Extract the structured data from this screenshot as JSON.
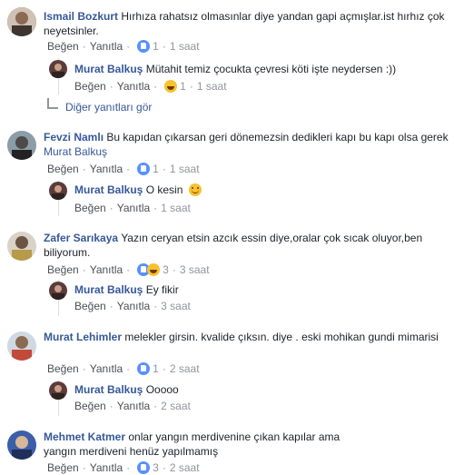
{
  "labels": {
    "like": "Beğen",
    "reply": "Yanıtla",
    "more_replies": "Diğer yanıtları gör"
  },
  "comments": [
    {
      "author": "Ismail Bozkurt",
      "text": "Hırhıza rahatsız olmasınlar diye yandan gapi açmışlar.ist hırhız çok neyetsinler.",
      "reaction": "like",
      "count": "1",
      "time": "1 saat",
      "reply": {
        "author": "Murat Balkuş",
        "text": "Mütahit temiz çocukta çevresi köti işte neydersen :))",
        "reaction": "haha",
        "count": "1",
        "time": "1 saat"
      }
    },
    {
      "author": "Fevzi Namlı",
      "text": "Bu kapıdan çıkarsan geri dönemezsin dedikleri kapı bu kapı olsa gerek",
      "mention": "Murat Balkuş",
      "reaction": "like",
      "count": "1",
      "time": "1 saat",
      "reply": {
        "author": "Murat Balkuş",
        "text": "O kesin",
        "reaction": "",
        "count": "",
        "time": "1 saat"
      }
    },
    {
      "author": "Zafer Sarıkaya",
      "text": "Yazın ceryan etsin azcık essin diye,oralar çok sıcak oluyor,ben biliyorum.",
      "reaction": "like+haha",
      "count": "3",
      "time": "3 saat",
      "reply": {
        "author": "Murat Balkuş",
        "text": "Ey fikir",
        "reaction": "",
        "count": "",
        "time": "3 saat"
      }
    },
    {
      "author": "Murat Lehimler",
      "text": "melekler girsin. kvalide çıksın. diye . eski mohikan gundi mimarisi",
      "reaction": "like",
      "count": "1",
      "time": "2 saat",
      "reply": {
        "author": "Murat Balkuş",
        "text": "Ooooo",
        "reaction": "",
        "count": "",
        "time": "2 saat"
      }
    },
    {
      "author": "Mehmet Katmer",
      "text": "onlar yangın merdivenine çıkan kapılar ama yangın merdiveni henüz yapılmamış",
      "reaction": "like",
      "count": "3",
      "time": "2 saat"
    }
  ],
  "colors": {
    "link": "#365899",
    "meta": "#90949c",
    "like": "#5890ff",
    "haha": "#f7c22e"
  }
}
